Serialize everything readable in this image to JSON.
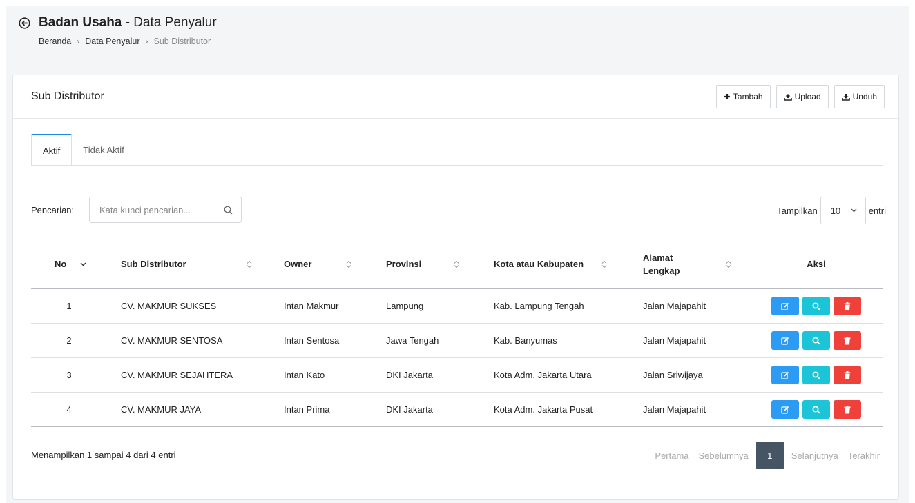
{
  "header": {
    "title_bold": "Badan Usaha",
    "title_rest": " - Data Penyalur",
    "breadcrumb": [
      "Beranda",
      "Data Penyalur",
      "Sub Distributor"
    ]
  },
  "card": {
    "title": "Sub Distributor",
    "actions": {
      "add_label": "Tambah",
      "upload_label": "Upload",
      "download_label": "Unduh"
    }
  },
  "tabs": [
    {
      "label": "Aktif",
      "active": true
    },
    {
      "label": "Tidak Aktif",
      "active": false
    }
  ],
  "filters": {
    "search_label": "Pencarian:",
    "search_placeholder": "Kata kunci pencarian...",
    "show_label": "Tampilkan",
    "show_value": "10",
    "show_suffix": "entri"
  },
  "table": {
    "columns": [
      "No",
      "Sub Distributor",
      "Owner",
      "Provinsi",
      "Kota atau Kabupaten",
      "Alamat Lengkap",
      "Aksi"
    ],
    "rows": [
      {
        "no": "1",
        "name": "CV. MAKMUR SUKSES",
        "owner": "Intan Makmur",
        "province": "Lampung",
        "city": "Kab. Lampung Tengah",
        "address": "Jalan Majapahit"
      },
      {
        "no": "2",
        "name": "CV. MAKMUR SENTOSA",
        "owner": "Intan Sentosa",
        "province": "Jawa Tengah",
        "city": "Kab. Banyumas",
        "address": "Jalan Majapahit"
      },
      {
        "no": "3",
        "name": "CV. MAKMUR SEJAHTERA",
        "owner": "Intan Kato",
        "province": "DKI Jakarta",
        "city": "Kota Adm. Jakarta Utara",
        "address": "Jalan Sriwijaya"
      },
      {
        "no": "4",
        "name": "CV. MAKMUR JAYA",
        "owner": "Intan Prima",
        "province": "DKI Jakarta",
        "city": "Kota Adm. Jakarta Pusat",
        "address": "Jalan Majapahit"
      }
    ]
  },
  "footer": {
    "info": "Menampilkan 1 sampai 4 dari 4 entri",
    "pager": {
      "first": "Pertama",
      "prev": "Sebelumnya",
      "current": "1",
      "next": "Selanjutnya",
      "last": "Terakhir"
    }
  },
  "colors": {
    "tab_accent": "#1e88e5",
    "edit_button": "#2b9bf4",
    "view_button": "#1cc4d8",
    "delete_button": "#f0403a",
    "active_page": "#455563"
  },
  "icons": {
    "back": "circle-arrow-left-icon",
    "add": "plus-icon",
    "upload": "upload-icon",
    "download": "download-icon",
    "search": "search-icon",
    "sort": "sort-icon",
    "sort_desc": "chevron-down-icon",
    "edit": "edit-icon",
    "view": "search-icon",
    "delete": "trash-icon"
  }
}
